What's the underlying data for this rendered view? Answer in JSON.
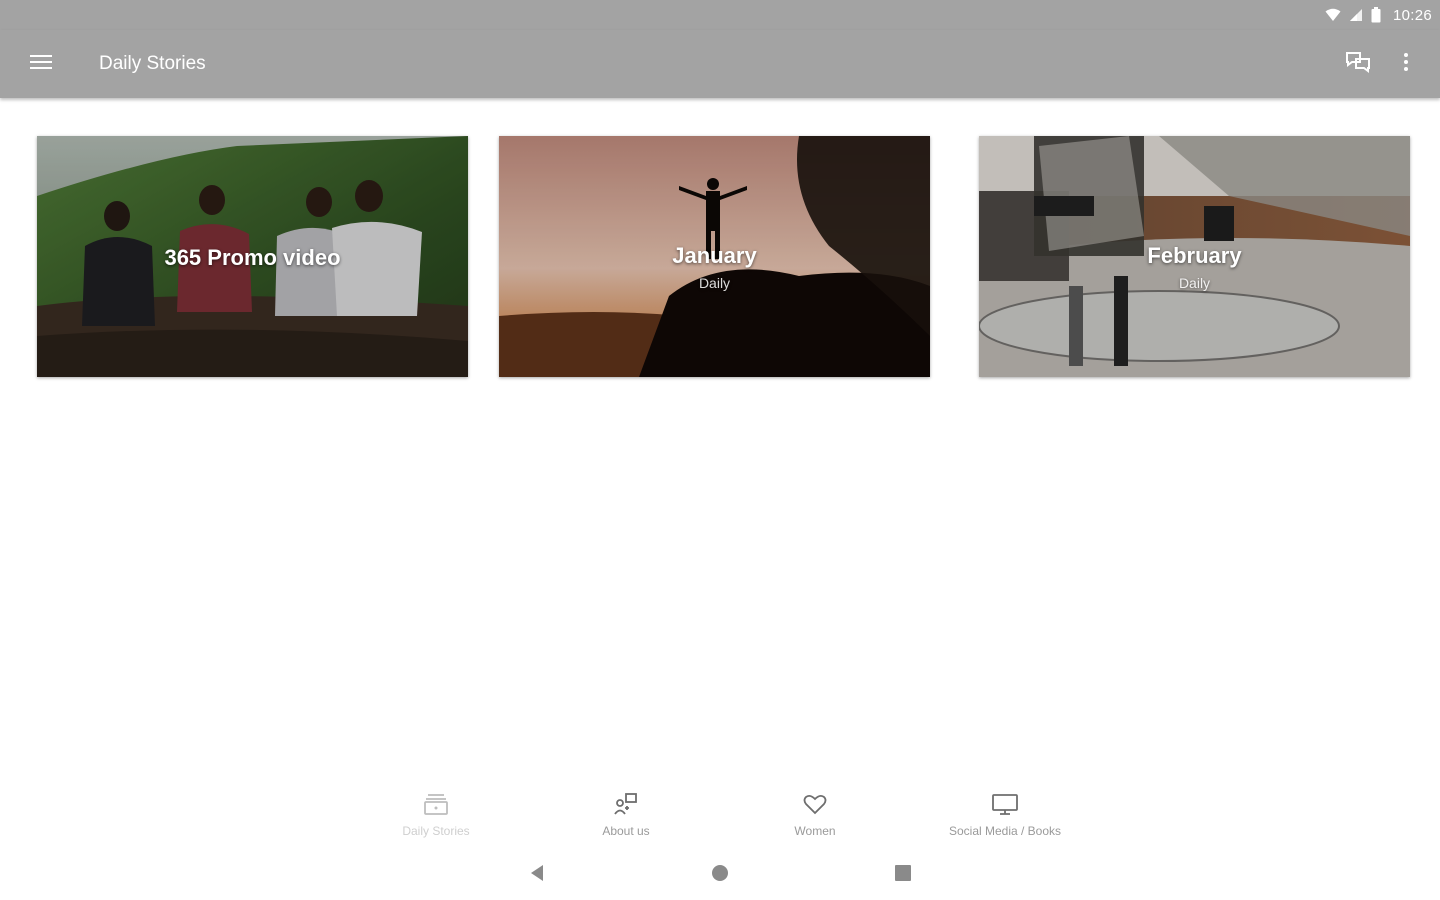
{
  "status_bar": {
    "time": "10:26",
    "icons": [
      "wifi-icon",
      "signal-icon",
      "battery-icon"
    ]
  },
  "app_bar": {
    "title": "Daily Stories",
    "icons": [
      "menu-icon",
      "chat-icon",
      "more-vert-icon"
    ]
  },
  "cards": [
    {
      "title": "365 Promo video",
      "subtitle": ""
    },
    {
      "title": "January",
      "subtitle": "Daily"
    },
    {
      "title": "February",
      "subtitle": "Daily"
    }
  ],
  "bottom_nav": {
    "items": [
      {
        "label": "Daily Stories",
        "icon": "daily-stories-icon",
        "active": true
      },
      {
        "label": "About us",
        "icon": "about-us-icon",
        "active": false
      },
      {
        "label": "Women",
        "icon": "heart-icon",
        "active": false
      },
      {
        "label": "Social Media / Books",
        "icon": "monitor-icon",
        "active": false
      }
    ]
  },
  "system_nav": {
    "icons": [
      "back-icon",
      "home-icon",
      "recents-icon"
    ]
  },
  "colors": {
    "app_bar": "#a3a3a3",
    "background": "#ffffff",
    "nav_icon": "#8a8a8a"
  }
}
